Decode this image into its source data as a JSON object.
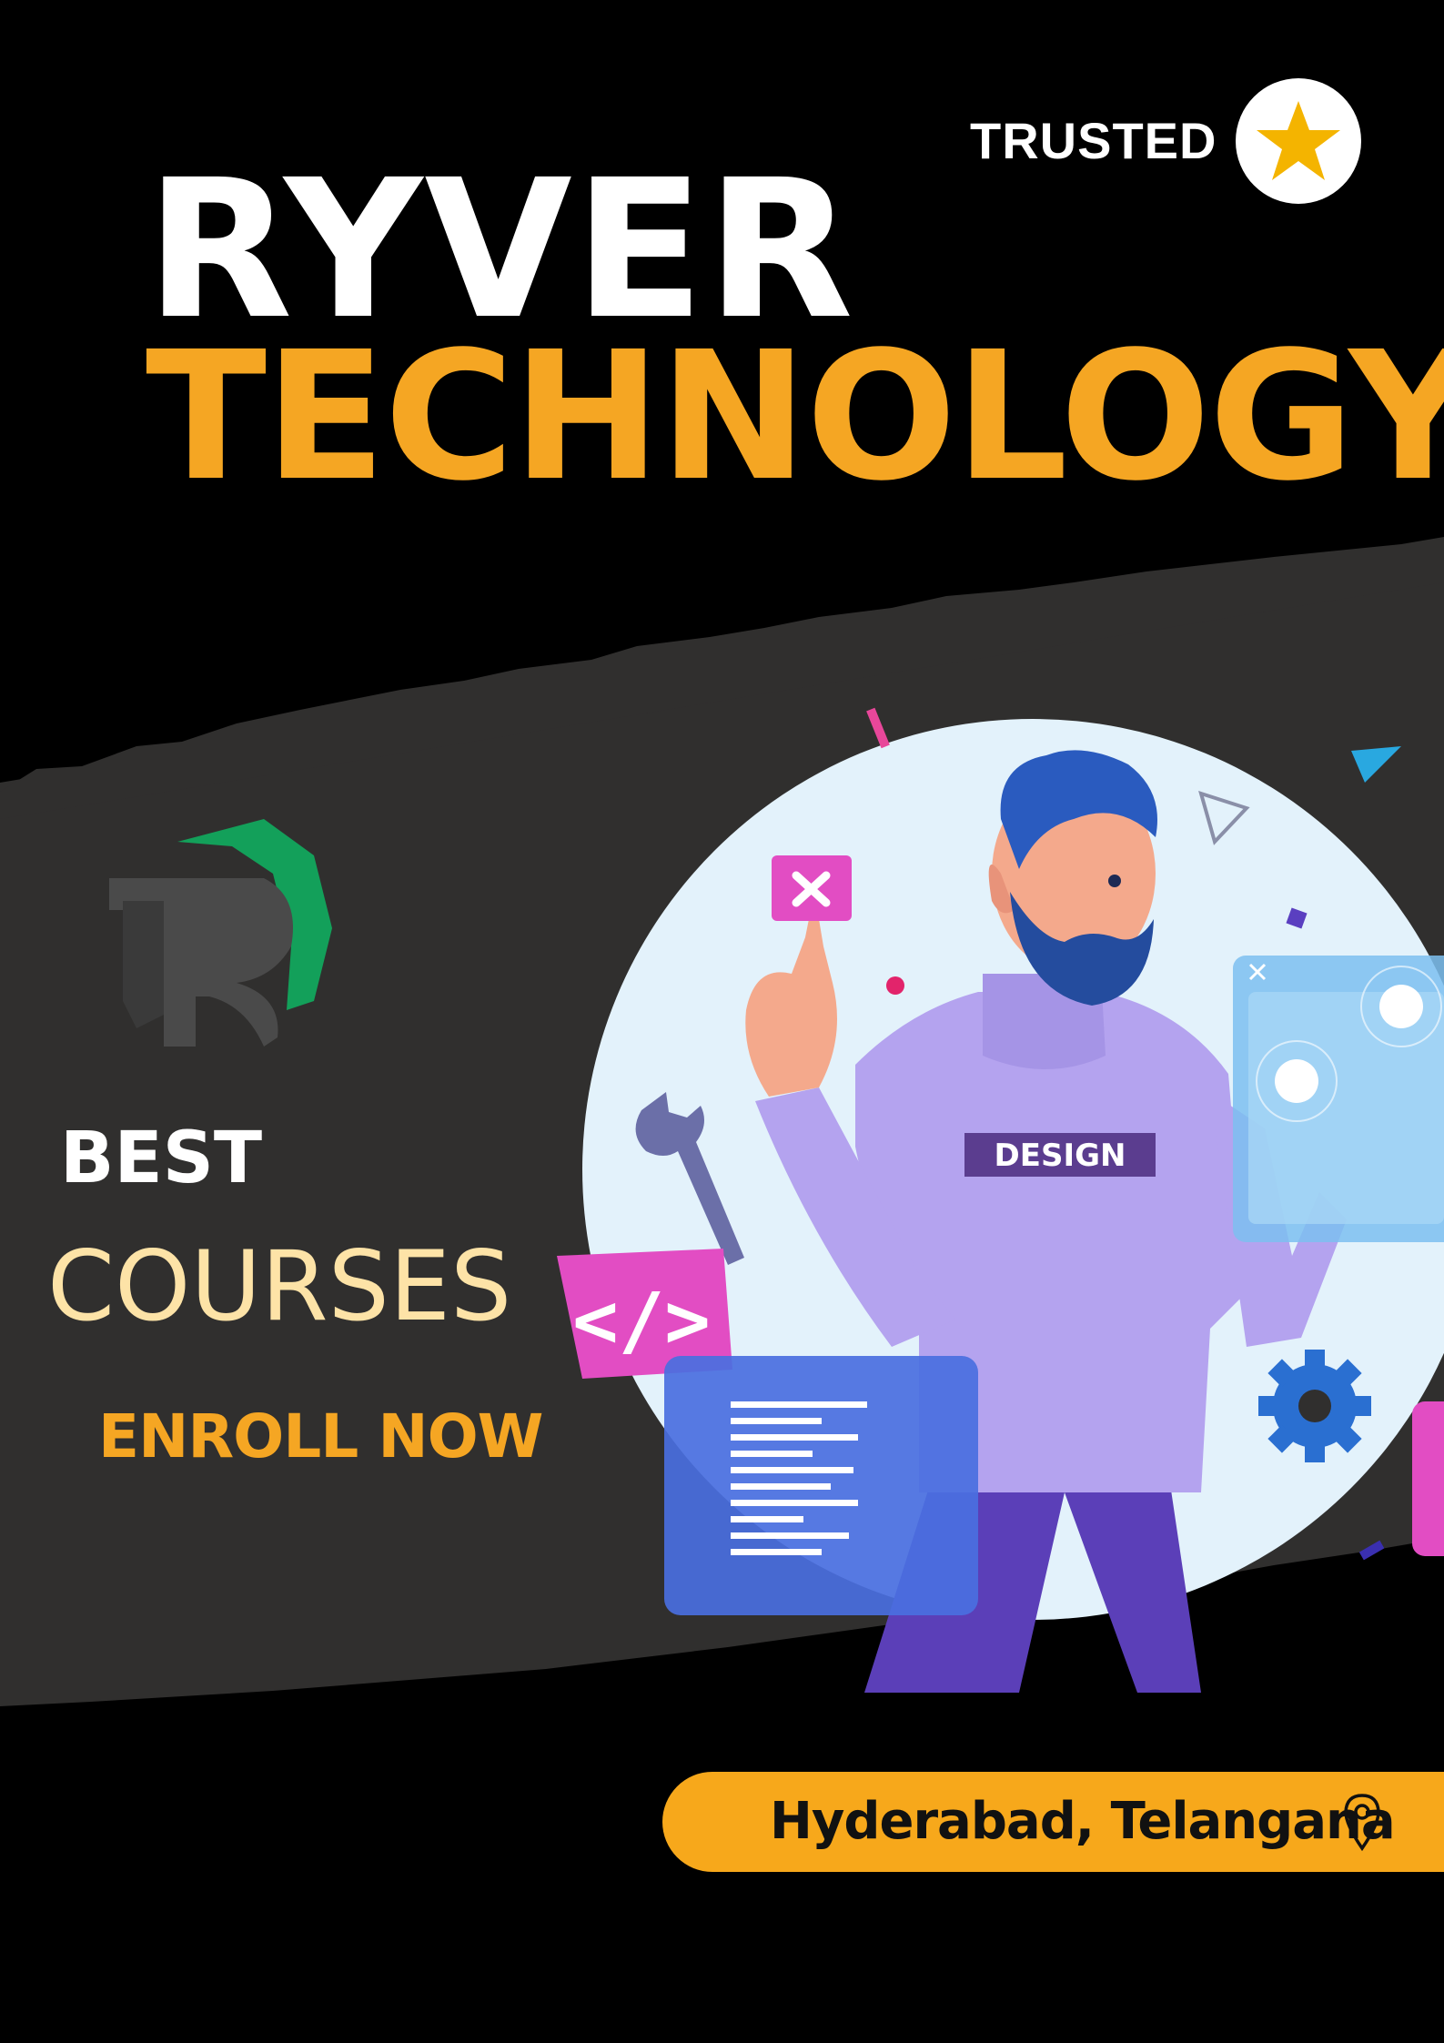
{
  "badge": {
    "label": "TRUSTED",
    "icon": "star-icon"
  },
  "title": {
    "line1": "RYVER",
    "line2": "TECHNOLOGY"
  },
  "promo": {
    "best": "BEST",
    "courses": "COURSES",
    "cta": "ENROLL NOW"
  },
  "illustration": {
    "shirt_text": "DESIGN"
  },
  "location": {
    "text": "Hyderabad, Telangana",
    "icon": "map-pin-icon"
  },
  "colors": {
    "background": "#000000",
    "band": "#302f2e",
    "accent": "#f5a623",
    "courses": "#fde3a7",
    "logo_green": "#13a05a",
    "logo_gray": "#4a4a4a"
  }
}
